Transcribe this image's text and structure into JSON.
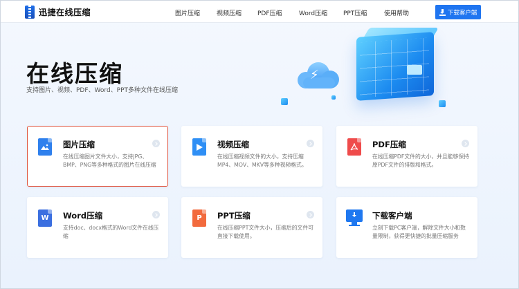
{
  "header": {
    "brand": "迅捷在线压缩",
    "nav": [
      {
        "label": "图片压缩"
      },
      {
        "label": "视频压缩"
      },
      {
        "label": "PDF压缩"
      },
      {
        "label": "Word压缩"
      },
      {
        "label": "PPT压缩"
      },
      {
        "label": "使用帮助"
      }
    ],
    "download_label": "下载客户端"
  },
  "hero": {
    "title": "在线压缩",
    "subtitle": "支持图片、视频、PDF、Word、PPT多种文件在线压缩"
  },
  "cards": [
    {
      "title": "图片压缩",
      "desc": "在线压缩图片文件大小，支持JPG、BMP、PNG等多种格式的图片在线压缩",
      "color": "#2f80ed"
    },
    {
      "title": "视频压缩",
      "desc": "在线压缩视频文件的大小，支持压缩MP4、MOV、MKV等多种视频格式。",
      "color": "#2f8ff5"
    },
    {
      "title": "PDF压缩",
      "desc": "在线压缩PDF文件的大小，并且能够保持原PDF文件的排版和格式。",
      "color": "#ef4b4b"
    },
    {
      "title": "Word压缩",
      "desc": "支持doc、docx格式的Word文件在线压缩",
      "color": "#3b6fe0"
    },
    {
      "title": "PPT压缩",
      "desc": "在线压缩PPT文件大小，压缩后的文件可直接下载使用。",
      "color": "#f26a3d"
    },
    {
      "title": "下载客户端",
      "desc": "立刻下载PC客户端，解除文件大小和数量限制，获得更快捷的批量压缩服务",
      "color": "#1f78f0"
    }
  ]
}
